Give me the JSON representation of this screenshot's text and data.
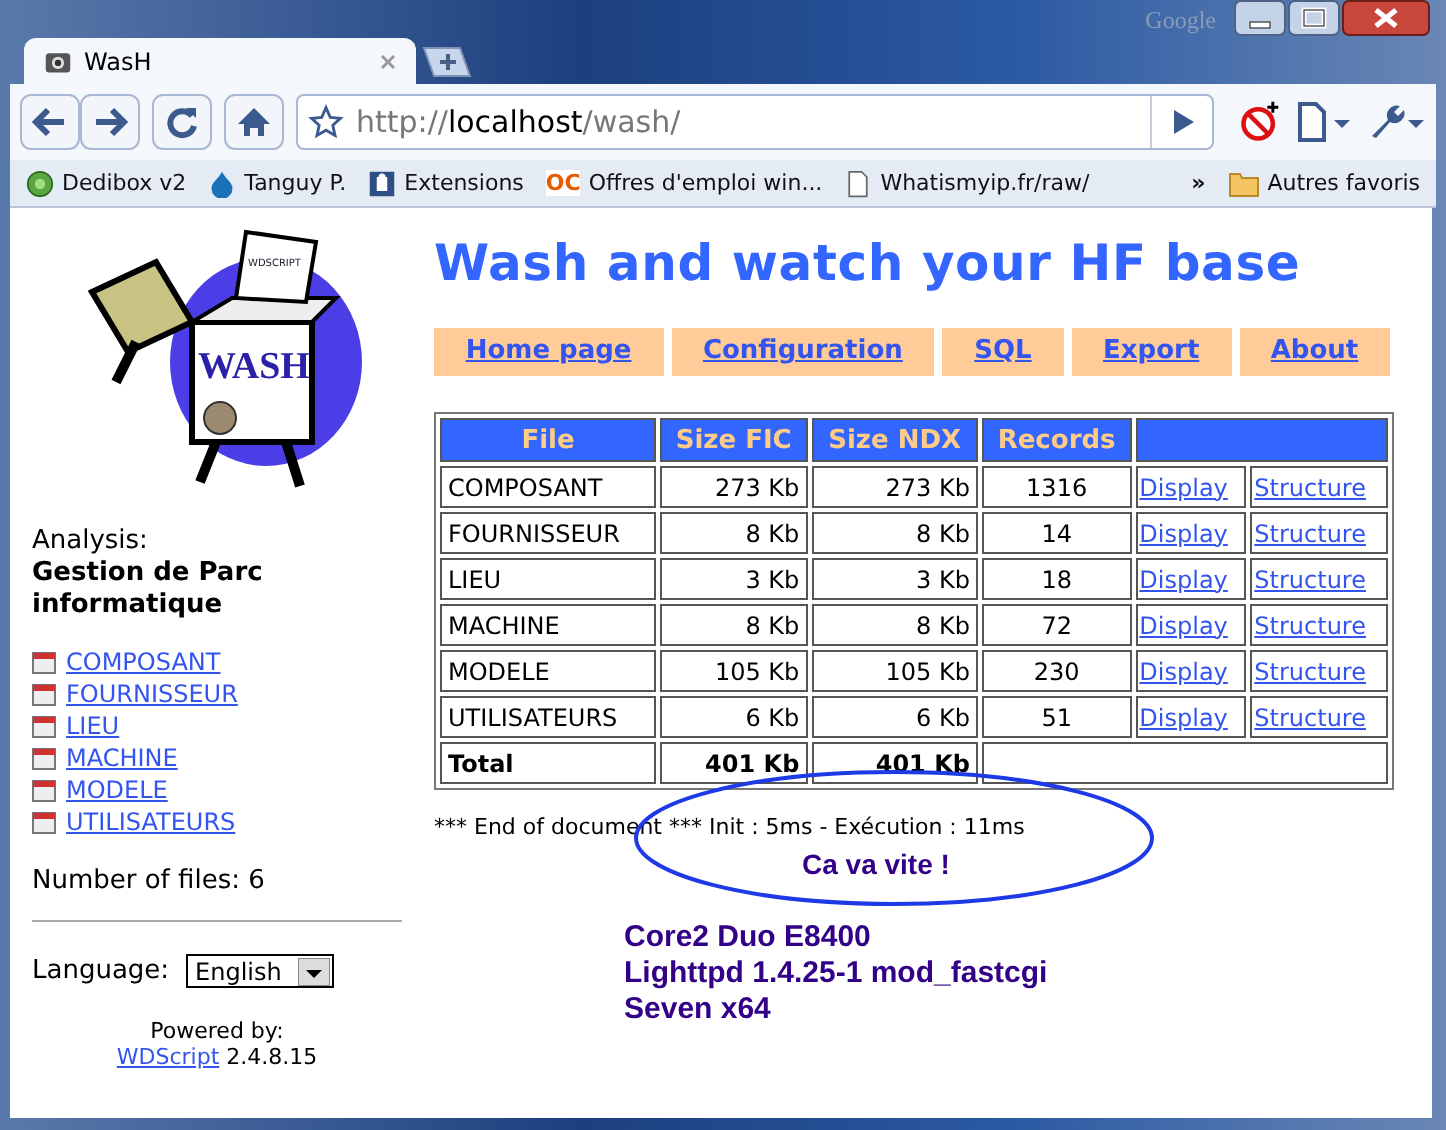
{
  "window": {
    "theme_label": "Google"
  },
  "tabs": [
    {
      "title": "WasH",
      "selected": true
    }
  ],
  "address": {
    "scheme": "http://",
    "host": "localhost",
    "path": "/wash/"
  },
  "bookmarks": [
    {
      "label": "Dedibox v2",
      "kind": "globe"
    },
    {
      "label": "Tanguy P.",
      "kind": "drop"
    },
    {
      "label": "Extensions",
      "kind": "puzzle"
    },
    {
      "label": "Offres d'emploi win...",
      "kind": "letters",
      "icon_text": "OC"
    },
    {
      "label": "Whatismyip.fr/raw/",
      "kind": "page"
    }
  ],
  "bookmarks_more": "»",
  "other_bookmarks": "Autres favoris",
  "sidebar": {
    "logo": {
      "title": "WASH",
      "tag": "WDSCRIPT"
    },
    "analysis_label": "Analysis:",
    "analysis_name": "Gestion de Parc informatique",
    "files": [
      "COMPOSANT",
      "FOURNISSEUR",
      "LIEU",
      "MACHINE",
      "MODELE",
      "UTILISATEURS"
    ],
    "file_count_label": "Number of files:",
    "file_count": "6",
    "language_label": "Language:",
    "language": "English",
    "powered_by": "Powered by:",
    "engine_link": "WDScript",
    "engine_version": "2.4.8.15"
  },
  "page": {
    "title": "Wash and watch your HF base",
    "nav": [
      "Home page",
      "Configuration",
      "SQL",
      "Export",
      "About"
    ],
    "table": {
      "columns": [
        "File",
        "Size FIC",
        "Size NDX",
        "Records"
      ],
      "rows": [
        {
          "file": "COMPOSANT",
          "size_fic": "273 Kb",
          "size_ndx": "273 Kb",
          "records": "1316",
          "actions": [
            "Display",
            "Structure"
          ]
        },
        {
          "file": "FOURNISSEUR",
          "size_fic": "8 Kb",
          "size_ndx": "8 Kb",
          "records": "14",
          "actions": [
            "Display",
            "Structure"
          ]
        },
        {
          "file": "LIEU",
          "size_fic": "3 Kb",
          "size_ndx": "3 Kb",
          "records": "18",
          "actions": [
            "Display",
            "Structure"
          ]
        },
        {
          "file": "MACHINE",
          "size_fic": "8 Kb",
          "size_ndx": "8 Kb",
          "records": "72",
          "actions": [
            "Display",
            "Structure"
          ]
        },
        {
          "file": "MODELE",
          "size_fic": "105 Kb",
          "size_ndx": "105 Kb",
          "records": "230",
          "actions": [
            "Display",
            "Structure"
          ]
        },
        {
          "file": "UTILISATEURS",
          "size_fic": "6 Kb",
          "size_ndx": "6 Kb",
          "records": "51",
          "actions": [
            "Display",
            "Structure"
          ]
        }
      ],
      "total": {
        "label": "Total",
        "size_fic": "401 Kb",
        "size_ndx": "401 Kb"
      }
    },
    "footer": "*** End of document *** Init : 5ms - Exécution : 11ms",
    "annotation": "Ca va vite !",
    "server_info": [
      "Core2 Duo E8400",
      "Lighttpd 1.4.25-1 mod_fastcgi",
      "Seven x64"
    ]
  }
}
